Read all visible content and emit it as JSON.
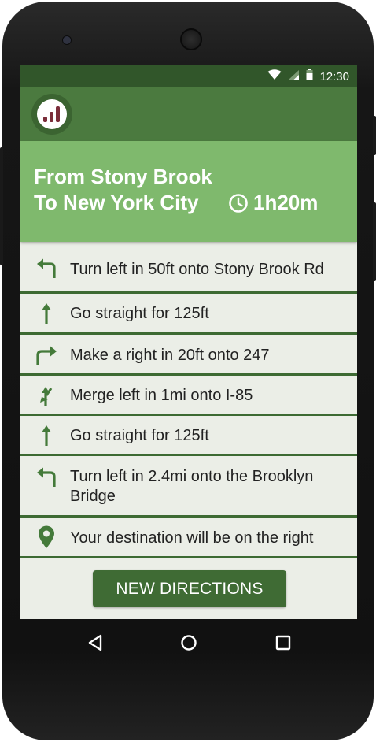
{
  "status_bar": {
    "time": "12:30",
    "icons": [
      "wifi-icon",
      "signal-icon",
      "battery-icon"
    ]
  },
  "app_bar": {
    "logo_icon": "bar-chart-logo-icon"
  },
  "route": {
    "from": "From Stony Brook",
    "to": "To New York City",
    "eta": "1h20m",
    "eta_icon": "clock-icon"
  },
  "directions": [
    {
      "icon": "turn-left-arrow-icon",
      "text": "Turn left in 50ft onto Stony Brook Rd"
    },
    {
      "icon": "straight-arrow-icon",
      "text": "Go straight for 125ft"
    },
    {
      "icon": "turn-right-arrow-icon",
      "text": "Make a right in 20ft onto 247"
    },
    {
      "icon": "merge-left-icon",
      "text": "Merge left in 1mi onto I-85"
    },
    {
      "icon": "straight-arrow-icon",
      "text": "Go straight for 125ft"
    },
    {
      "icon": "turn-left-arrow-icon",
      "text": "Turn left in 2.4mi onto the Brooklyn Bridge"
    },
    {
      "icon": "location-pin-icon",
      "text": "Your destination will be on the right"
    }
  ],
  "new_directions_button": "NEW DIRECTIONS",
  "colors": {
    "status_bar": "#31562a",
    "app_bar": "#4b7a3f",
    "header": "#7fb96d",
    "accent": "#3f6b34",
    "list_bg": "#ebeee7"
  },
  "nav_bar": {
    "back_icon": "back-triangle-icon",
    "home_icon": "home-circle-icon",
    "recents_icon": "recents-square-icon"
  }
}
